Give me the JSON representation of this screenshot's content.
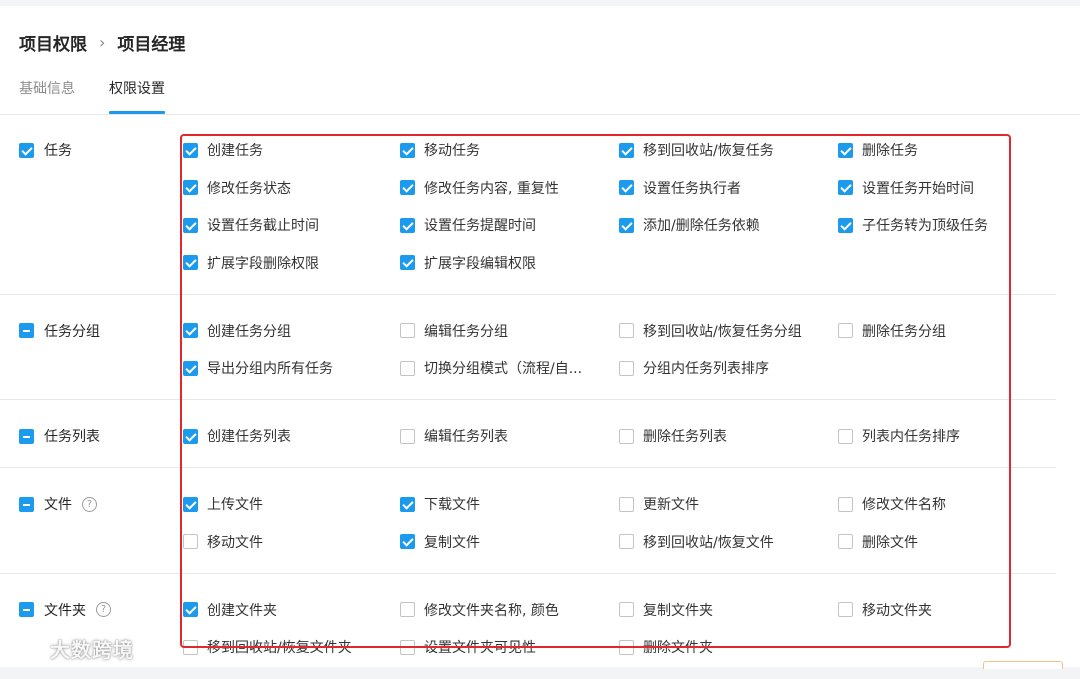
{
  "breadcrumb": {
    "parent": "项目权限",
    "separator": "›",
    "current": "项目经理"
  },
  "tabs": [
    {
      "label": "基础信息",
      "active": false
    },
    {
      "label": "权限设置",
      "active": true
    }
  ],
  "accent_color": "#1b9aee",
  "highlight_color": "#e0282e",
  "groups": [
    {
      "label": "任务",
      "state": "checked",
      "help": false,
      "items": [
        {
          "label": "创建任务",
          "checked": true
        },
        {
          "label": "移动任务",
          "checked": true
        },
        {
          "label": "移到回收站/恢复任务",
          "checked": true
        },
        {
          "label": "删除任务",
          "checked": true
        },
        {
          "label": "修改任务状态",
          "checked": true
        },
        {
          "label": "修改任务内容, 重复性",
          "checked": true
        },
        {
          "label": "设置任务执行者",
          "checked": true
        },
        {
          "label": "设置任务开始时间",
          "checked": true
        },
        {
          "label": "设置任务截止时间",
          "checked": true
        },
        {
          "label": "设置任务提醒时间",
          "checked": true
        },
        {
          "label": "添加/删除任务依赖",
          "checked": true
        },
        {
          "label": "子任务转为顶级任务",
          "checked": true
        },
        {
          "label": "扩展字段删除权限",
          "checked": true
        },
        {
          "label": "扩展字段编辑权限",
          "checked": true
        }
      ]
    },
    {
      "label": "任务分组",
      "state": "mixed",
      "help": false,
      "items": [
        {
          "label": "创建任务分组",
          "checked": true
        },
        {
          "label": "编辑任务分组",
          "checked": false
        },
        {
          "label": "移到回收站/恢复任务分组",
          "checked": false
        },
        {
          "label": "删除任务分组",
          "checked": false
        },
        {
          "label": "导出分组内所有任务",
          "checked": true
        },
        {
          "label": "切换分组模式（流程/自...",
          "checked": false
        },
        {
          "label": "分组内任务列表排序",
          "checked": false
        }
      ]
    },
    {
      "label": "任务列表",
      "state": "mixed",
      "help": false,
      "items": [
        {
          "label": "创建任务列表",
          "checked": true
        },
        {
          "label": "编辑任务列表",
          "checked": false
        },
        {
          "label": "删除任务列表",
          "checked": false
        },
        {
          "label": "列表内任务排序",
          "checked": false
        }
      ]
    },
    {
      "label": "文件",
      "state": "mixed",
      "help": true,
      "items": [
        {
          "label": "上传文件",
          "checked": true
        },
        {
          "label": "下载文件",
          "checked": true
        },
        {
          "label": "更新文件",
          "checked": false
        },
        {
          "label": "修改文件名称",
          "checked": false
        },
        {
          "label": "移动文件",
          "checked": false
        },
        {
          "label": "复制文件",
          "checked": true
        },
        {
          "label": "移到回收站/恢复文件",
          "checked": false
        },
        {
          "label": "删除文件",
          "checked": false
        }
      ]
    },
    {
      "label": "文件夹",
      "state": "mixed",
      "help": true,
      "items": [
        {
          "label": "创建文件夹",
          "checked": true
        },
        {
          "label": "修改文件夹名称, 颜色",
          "checked": false
        },
        {
          "label": "复制文件夹",
          "checked": false
        },
        {
          "label": "移动文件夹",
          "checked": false
        },
        {
          "label": "移到回收站/恢复文件夹",
          "checked": false
        },
        {
          "label": "设置文件夹可见性",
          "checked": false
        },
        {
          "label": "删除文件夹",
          "checked": false
        }
      ]
    }
  ],
  "watermark": {
    "text": "大数跨境",
    "icon": "watermark-logo-icon"
  }
}
